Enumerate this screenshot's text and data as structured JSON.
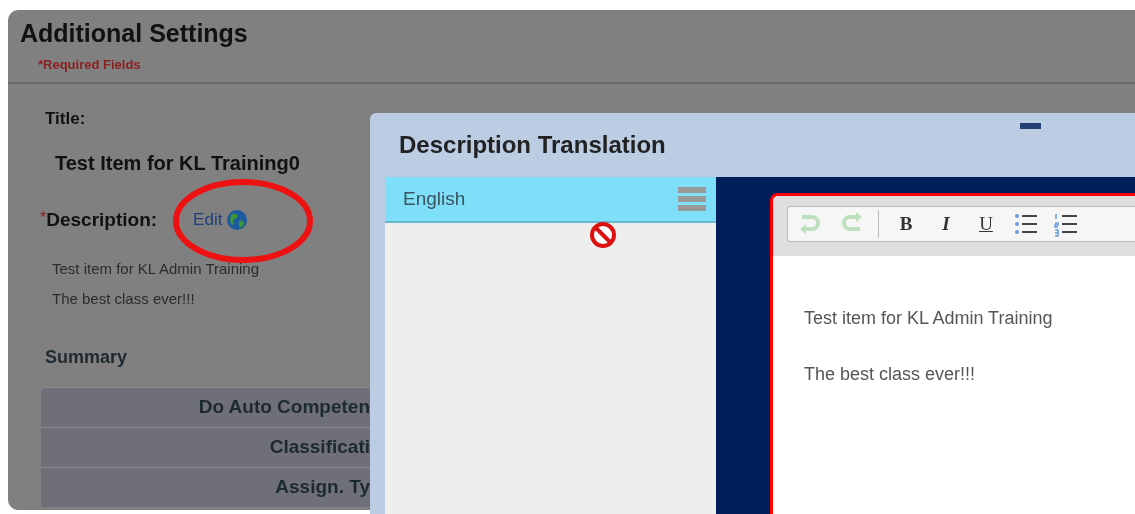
{
  "page": {
    "title": "Additional Settings",
    "required_note": "*Required Fields",
    "title_label": "Title:",
    "title_value": "Test Item for KL Training0",
    "required_mark": "*",
    "description_label": "Description:",
    "description_link": "Edit",
    "description_lines": [
      "Test item for KL Admin Training",
      "The best class ever!!!"
    ],
    "summary_heading": "Summary",
    "summary_rows": [
      "Do Auto Competen",
      "Classificati",
      "Assign. Ty"
    ]
  },
  "dialog": {
    "title": "Description Translation",
    "languages": [
      {
        "label": "English",
        "selected": true
      }
    ],
    "toolbar": [
      {
        "kind": "undo",
        "disabled": true
      },
      {
        "kind": "redo",
        "disabled": true
      },
      {
        "kind": "bold",
        "label": "B"
      },
      {
        "kind": "italic",
        "label": "I"
      },
      {
        "kind": "underline",
        "label": "U"
      },
      {
        "kind": "bullets"
      },
      {
        "kind": "numbers"
      }
    ],
    "editor_lines": [
      "Test item for KL Admin Training",
      "The best class ever!!!"
    ]
  }
}
